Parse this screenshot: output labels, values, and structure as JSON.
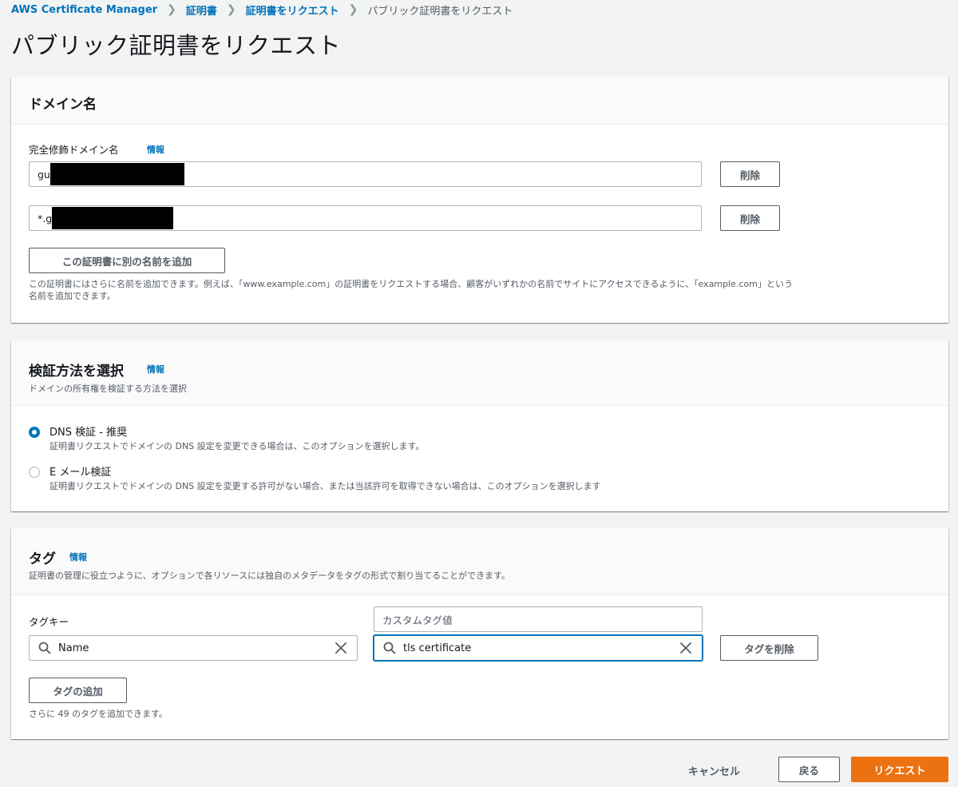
{
  "breadcrumb": {
    "items": [
      "AWS Certificate Manager",
      "証明書",
      "証明書をリクエスト"
    ],
    "current": "パブリック証明書をリクエスト"
  },
  "page_title": "パブリック証明書をリクエスト",
  "domain_section": {
    "title": "ドメイン名",
    "field_label": "完全修飾ドメイン名",
    "info": "情報",
    "domains": [
      {
        "value": "gu",
        "remove_label": "削除"
      },
      {
        "value": "*.g",
        "remove_label": "削除"
      }
    ],
    "add_button": "この証明書に別の名前を追加",
    "hint_line1": "この証明書にはさらに名前を追加できます。例えば、「www.example.com」の証明書をリクエストする場合、顧客がいずれかの名前でサイトにアクセスできるように、「example.com」という",
    "hint_line2": "名前を追加できます。"
  },
  "validation_section": {
    "title": "検証方法を選択",
    "info": "情報",
    "description": "ドメインの所有権を検証する方法を選択",
    "options": [
      {
        "label": "DNS 検証 - 推奨",
        "description": "証明書リクエストでドメインの DNS 設定を変更できる場合は、このオプションを選択します。",
        "selected": true
      },
      {
        "label": "E メール検証",
        "description": "証明書リクエストでドメインの DNS 設定を変更する許可がない場合、または当該許可を取得できない場合は、このオプションを選択します",
        "selected": false
      }
    ]
  },
  "tags_section": {
    "title": "タグ",
    "info": "情報",
    "description": "証明書の管理に役立つように、オプションで各リソースには独自のメタデータをタグの形式で割り当てることができます。",
    "key_label": "タグキー",
    "value_label": "カスタムタグ値",
    "tag_key": "Name",
    "tag_value": "tls certificate",
    "remove_tag": "タグを削除",
    "add_tag": "タグの追加",
    "remaining": "さらに 49 のタグを追加できます。"
  },
  "footer": {
    "cancel": "キャンセル",
    "back": "戻る",
    "submit": "リクエスト"
  },
  "colors": {
    "link": "#0073bb",
    "primary": "#ec7211",
    "background": "#f2f3f3"
  }
}
